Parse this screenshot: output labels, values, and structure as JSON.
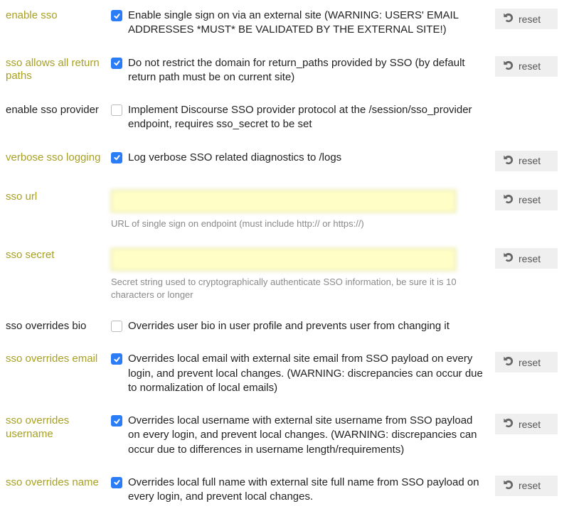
{
  "reset_label": "reset",
  "settings": [
    {
      "key": "enable_sso",
      "label": "enable sso",
      "overridden": true,
      "type": "checkbox",
      "checked": true,
      "desc": "Enable single sign on via an external site (WARNING: USERS' EMAIL ADDRESSES *MUST* BE VALIDATED BY THE EXTERNAL SITE!)",
      "has_reset": true
    },
    {
      "key": "sso_allows_all_return_paths",
      "label": "sso allows all return paths",
      "overridden": true,
      "type": "checkbox",
      "checked": true,
      "desc": "Do not restrict the domain for return_paths provided by SSO (by default return path must be on current site)",
      "has_reset": true
    },
    {
      "key": "enable_sso_provider",
      "label": "enable sso provider",
      "overridden": false,
      "type": "checkbox",
      "checked": false,
      "desc": "Implement Discourse SSO provider protocol at the /session/sso_provider endpoint, requires sso_secret to be set",
      "has_reset": false
    },
    {
      "key": "verbose_sso_logging",
      "label": "verbose sso logging",
      "overridden": true,
      "type": "checkbox",
      "checked": true,
      "desc": "Log verbose SSO related diagnostics to /logs",
      "has_reset": true
    },
    {
      "key": "sso_url",
      "label": "sso url",
      "overridden": true,
      "type": "text",
      "value": "",
      "blurred": true,
      "help": "URL of single sign on endpoint (must include http:// or https://)",
      "has_reset": true
    },
    {
      "key": "sso_secret",
      "label": "sso secret",
      "overridden": true,
      "type": "text",
      "value": "",
      "blurred": true,
      "help": "Secret string used to cryptographically authenticate SSO information, be sure it is 10 characters or longer",
      "has_reset": true
    },
    {
      "key": "sso_overrides_bio",
      "label": "sso overrides bio",
      "overridden": false,
      "type": "checkbox",
      "checked": false,
      "desc": "Overrides user bio in user profile and prevents user from changing it",
      "has_reset": false
    },
    {
      "key": "sso_overrides_email",
      "label": "sso overrides email",
      "overridden": true,
      "type": "checkbox",
      "checked": true,
      "desc": "Overrides local email with external site email from SSO payload on every login, and prevent local changes. (WARNING: discrepancies can occur due to normalization of local emails)",
      "has_reset": true
    },
    {
      "key": "sso_overrides_username",
      "label": "sso overrides username",
      "overridden": true,
      "type": "checkbox",
      "checked": true,
      "desc": "Overrides local username with external site username from SSO payload on every login, and prevent local changes. (WARNING: discrepancies can occur due to differences in username length/requirements)",
      "has_reset": true
    },
    {
      "key": "sso_overrides_name",
      "label": "sso overrides name",
      "overridden": true,
      "type": "checkbox",
      "checked": true,
      "desc": "Overrides local full name with external site full name from SSO payload on every login, and prevent local changes.",
      "has_reset": true
    }
  ]
}
